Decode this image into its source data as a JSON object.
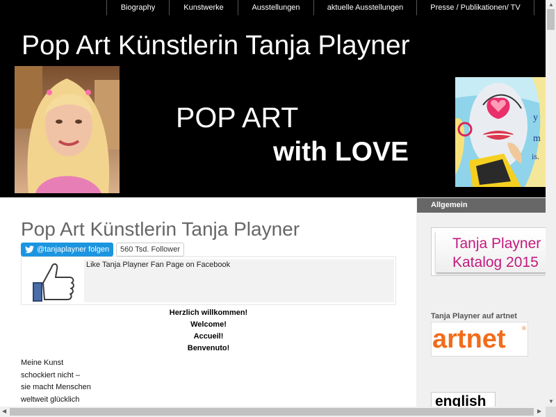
{
  "nav": {
    "items": [
      {
        "label": "Biography",
        "width": 0
      },
      {
        "label": "Kunstwerke"
      },
      {
        "label": "Ausstellungen"
      },
      {
        "label": "aktuelle Ausstellungen"
      },
      {
        "label": "Presse / Publikationen/ TV"
      }
    ]
  },
  "header": {
    "title": "Pop Art Künstlerin Tanja Playner",
    "slogan_line1": "POP ART",
    "slogan_line2": "with LOVE"
  },
  "main": {
    "title": "Pop Art Künstlerin Tanja Playner",
    "twitter_button": "@tanjaplayner folgen",
    "twitter_count": "560 Tsd. Follower",
    "facebook_text": "Like Tanja Playner Fan Page on Facebook",
    "welcome": [
      "Herzlich willkommen!",
      "Welcome!",
      "Accueil!",
      "Benvenuto!"
    ],
    "poem": [
      "Meine Kunst",
      "schockiert nicht –",
      "sie macht Menschen",
      "weltweit glücklich"
    ]
  },
  "sidebar": {
    "heading": "Allgemein",
    "katalog_line1": "Tanja Playner",
    "katalog_line2": "Katalog 2015",
    "artnet_label": "Tanja Playner auf artnet",
    "artnet_logo": "artnet",
    "artnet_reg": "®",
    "english_label": "english"
  },
  "colors": {
    "header_bg": "#000000",
    "twitter_blue": "#1b95e0",
    "sidebar_heading_bg": "#676767",
    "katalog_pink": "#c2197e",
    "artnet_orange": "#f26c1a",
    "main_title_gray": "#666666"
  }
}
